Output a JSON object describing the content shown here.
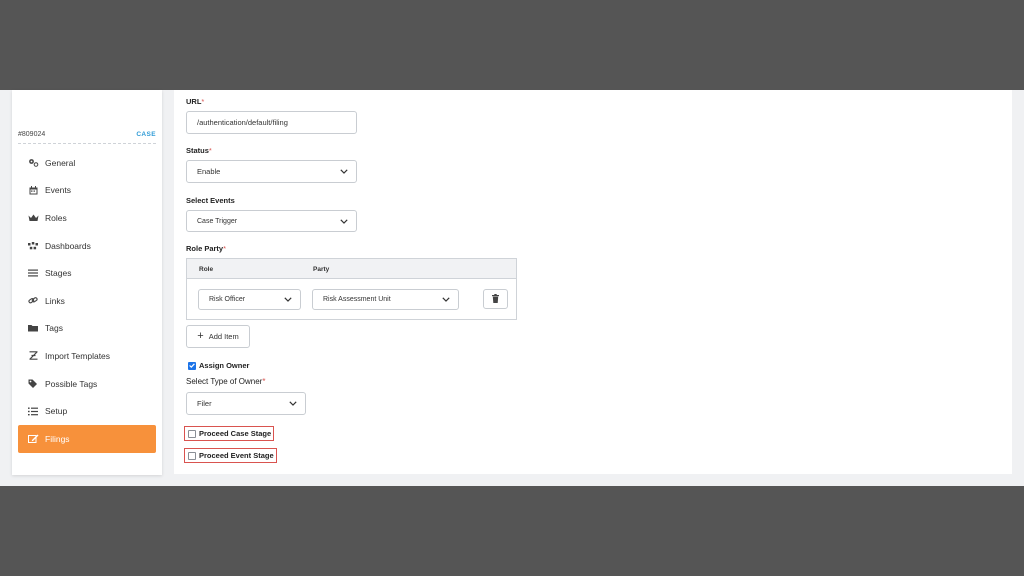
{
  "sidebar": {
    "record_id": "#809024",
    "badge": "CASE",
    "items": [
      {
        "label": "General",
        "icon": "gears-icon",
        "active": false
      },
      {
        "label": "Events",
        "icon": "calendar-icon",
        "active": false
      },
      {
        "label": "Roles",
        "icon": "crown-icon",
        "active": false
      },
      {
        "label": "Dashboards",
        "icon": "dashboard-icon",
        "active": false
      },
      {
        "label": "Stages",
        "icon": "list-icon",
        "active": false
      },
      {
        "label": "Links",
        "icon": "link-icon",
        "active": false
      },
      {
        "label": "Tags",
        "icon": "folder-icon",
        "active": false
      },
      {
        "label": "Import Templates",
        "icon": "import-icon",
        "active": false
      },
      {
        "label": "Possible Tags",
        "icon": "tags-icon",
        "active": false
      },
      {
        "label": "Setup",
        "icon": "list-ordered-icon",
        "active": false
      },
      {
        "label": "Filings",
        "icon": "edit-icon",
        "active": true
      }
    ]
  },
  "form": {
    "url_label": "URL",
    "url_value": "/authentication/default/filing",
    "status_label": "Status",
    "status_value": "Enable",
    "events_label": "Select Events",
    "events_value": "Case Trigger",
    "role_party_label": "Role Party",
    "role_party": {
      "col_role": "Role",
      "col_party": "Party",
      "row": {
        "role": "Risk Officer",
        "party": "Risk Assessment Unit"
      }
    },
    "add_item_label": "Add Item",
    "assign_owner_label": "Assign Owner",
    "assign_owner_checked": true,
    "owner_type_label": "Select Type of Owner",
    "owner_type_value": "Filer",
    "proceed_case_label": "Proceed Case Stage",
    "proceed_event_label": "Proceed Event Stage",
    "required_mark": "*"
  },
  "colors": {
    "accent": "#f7913b",
    "link": "#2f9bd6",
    "error_outline": "#d9534f",
    "checkbox": "#1b73e8"
  }
}
